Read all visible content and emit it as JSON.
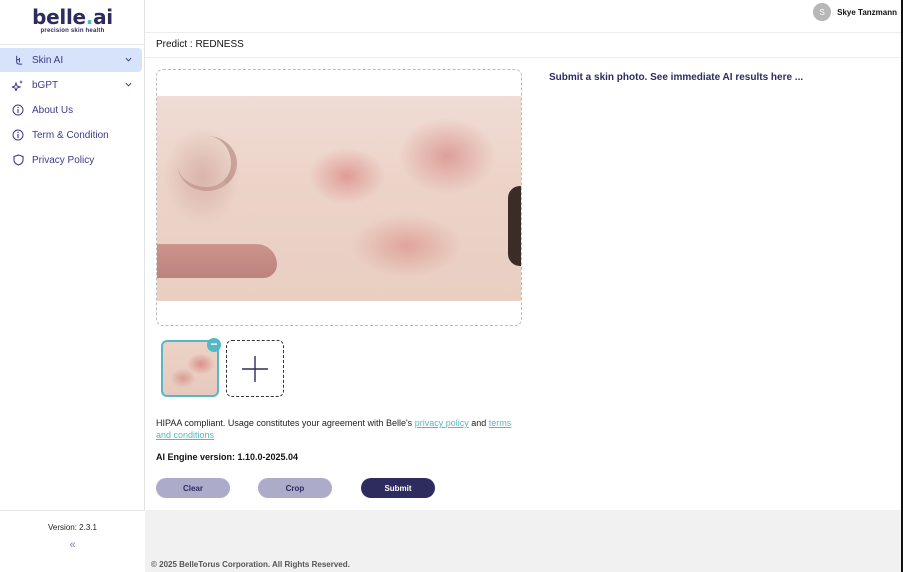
{
  "brand": {
    "name_part1": "belle",
    "name_dot": ".",
    "name_part2": "ai",
    "tagline": "precision skin health"
  },
  "header": {
    "user": {
      "initial": "S",
      "name": "Skye Tanzmann"
    }
  },
  "sidebar": {
    "items": [
      {
        "label": "Skin AI",
        "icon": "skin-ai-icon",
        "active": true,
        "expandable": true
      },
      {
        "label": "bGPT",
        "icon": "sparkle-icon",
        "active": false,
        "expandable": true
      },
      {
        "label": "About Us",
        "icon": "info-icon",
        "active": false,
        "expandable": false
      },
      {
        "label": "Term & Condition",
        "icon": "info-icon",
        "active": false,
        "expandable": false
      },
      {
        "label": "Privacy Policy",
        "icon": "shield-icon",
        "active": false,
        "expandable": false
      }
    ],
    "version": "Version: 2.3.1",
    "collapse_symbol": "«"
  },
  "predict": {
    "label": "Predict : REDNESS"
  },
  "upload": {
    "thumbnail_count": 1,
    "remove_symbol": "−",
    "add_symbol": "+"
  },
  "hipaa": {
    "text_before": "HIPAA compliant. Usage constitutes your agreement with Belle's ",
    "privacy_link": "privacy policy",
    "text_middle": " and ",
    "terms_link": "terms and conditions"
  },
  "engine": {
    "label": "AI Engine version: 1.10.0-2025.04"
  },
  "buttons": {
    "clear": "Clear",
    "crop": "Crop",
    "submit": "Submit"
  },
  "result": {
    "message": "Submit a skin photo. See immediate AI results here ..."
  },
  "footer": {
    "copyright": "© 2025 BelleTorus Corporation. All Rights Reserved."
  },
  "colors": {
    "brand_navy": "#2e2b5f",
    "accent_teal": "#56b8c7",
    "active_nav_bg": "#d7e2fb",
    "secondary_button": "#acabca"
  }
}
